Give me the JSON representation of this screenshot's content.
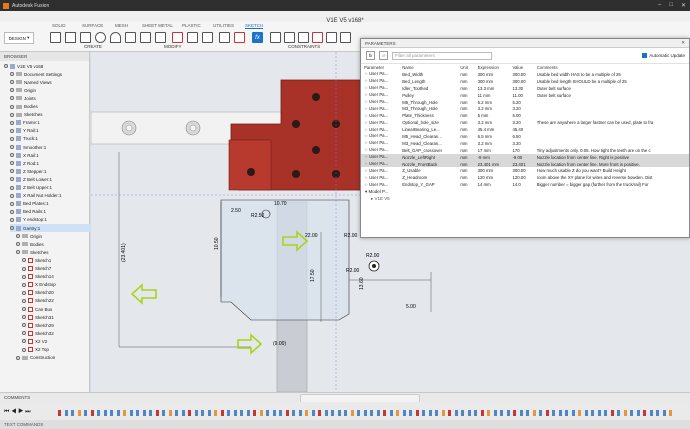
{
  "app": {
    "title": "Autodesk Fusion",
    "doc_title": "V1E V5 v168*"
  },
  "ribbon": {
    "tabs": [
      "SOLID",
      "SURFACE",
      "MESH",
      "SHEET METAL",
      "PLASTIC",
      "UTILITIES",
      "SKETCH"
    ],
    "active_tab": "SKETCH",
    "workspace": "DESIGN",
    "groups": [
      "CREATE",
      "MODIFY",
      "CONSTRAINTS"
    ]
  },
  "browser": {
    "title": "BROWSER",
    "items": [
      "V1E V5 v168",
      "Document Settings",
      "Named Views",
      "Origin",
      "Joints",
      "Bodies",
      "Sketches",
      "Frame:1",
      "Y Rail:1",
      "Truck:1",
      "Smoother:1",
      "X Rail:1",
      "Z Rod:1",
      "Z Stepper:1",
      "Z Belt Lower:1",
      "Z Belt Upper:1",
      "X Rail Nut Holder:1",
      "Bed Plates:1",
      "Bed Rails:1",
      "Y endstop:1",
      "Gantry:1",
      "Origin",
      "Bodies",
      "Sketches",
      "Sketch1",
      "Sketch7",
      "Sketch14",
      "X Endstop",
      "Sketch20",
      "Sketch22",
      "Can Bus",
      "Sketch31",
      "Sketch29",
      "Sketch32",
      "X2 V2",
      "X2 Top",
      "Construction"
    ]
  },
  "params": {
    "title": "PARAMETERS",
    "filter_placeholder": "Filter all parameters",
    "auto_update": "Automatic Update",
    "columns": [
      "Parameter",
      "Name",
      "Unit",
      "Expression",
      "Value",
      "Comments"
    ],
    "rows": [
      [
        "User Pa...",
        "Bed_Width",
        "mm",
        "300 mm",
        "300.00",
        "Usable bed width HAS to be a multiple of 25"
      ],
      [
        "User Pa...",
        "Bed_Length",
        "mm",
        "300 mm",
        "300.00",
        "Usable bed length SHOULD be a multiple of 25"
      ],
      [
        "User Pa...",
        "Idler_Toothed",
        "mm",
        "13.3 mm",
        "13.30",
        "Outer belt surface"
      ],
      [
        "User Pa...",
        "Pulley",
        "mm",
        "11 mm",
        "11.00",
        "Outer belt surface"
      ],
      [
        "User Pa...",
        "M5_Through_Hole",
        "mm",
        "5.2 mm",
        "5.20",
        ""
      ],
      [
        "User Pa...",
        "M3_Through_Hole",
        "mm",
        "3.2 mm",
        "3.20",
        ""
      ],
      [
        "User Pa...",
        "Plate_Thickness",
        "mm",
        "5 mm",
        "5.00",
        ""
      ],
      [
        "User Pa...",
        "Optional_hole_size",
        "mm",
        "3.2 mm",
        "3.20",
        "These are anywhere a larger fastner can be used, plate to fra"
      ],
      [
        "User Pa...",
        "LinearBearing_Le...",
        "mm",
        "45.4 mm",
        "45.40",
        ""
      ],
      [
        "User Pa...",
        "M5_Head_Clearan...",
        "mm",
        "6.5 mm",
        "6.50",
        ""
      ],
      [
        "User Pa...",
        "M3_Head_Clearan...",
        "mm",
        "3.2 mm",
        "3.20",
        ""
      ],
      [
        "User Pa...",
        "Belt_GAP_crossover",
        "mm",
        "17 mm",
        "170",
        "Tiny adjustments only. 0.05. How tight the teeth are on the c"
      ],
      [
        "User Pa...",
        "Nozzle_LeftRight",
        "mm",
        "-9 mm",
        "-9.00",
        "Nozzle location from center line. Right is positive"
      ],
      [
        "User Pa...",
        "Nozzle_FrontBack",
        "mm",
        "23.401 mm",
        "23.401",
        "Nozzle location from center line. More front is positive."
      ],
      [
        "User Pa...",
        "Z_Usable",
        "mm",
        "300 mm",
        "300.00",
        "How much usable Z do you want? Build Height"
      ],
      [
        "User Pa...",
        "Z_Headroom",
        "mm",
        "120 mm",
        "120.00",
        "room above the XY plane for wires and reverse bowden. Dist"
      ],
      [
        "User Pa...",
        "Endstop_Y_GAP",
        "mm",
        "14 mm",
        "14.0",
        "Bigger number = bigger gap (further from the truck/rail) For"
      ]
    ],
    "highlight_rows": [
      12,
      13
    ],
    "model_section": "Model P...",
    "model_sub": "V1E V5"
  },
  "canvas": {
    "dimensions": [
      "10.70",
      "2.50",
      "22.00",
      "17.50",
      "(23.401)",
      "(9.00)",
      "5.00",
      "R2.00",
      "R2.00",
      "R2.50",
      "10.50",
      "13.60",
      "R2.00"
    ]
  },
  "bottom": {
    "comments": "COMMENTS",
    "text_commands": "TEXT COMMANDS"
  },
  "colors": {
    "red_part": "#a83228",
    "accent": "#1a73c9",
    "arrow": "#a8d41a"
  }
}
